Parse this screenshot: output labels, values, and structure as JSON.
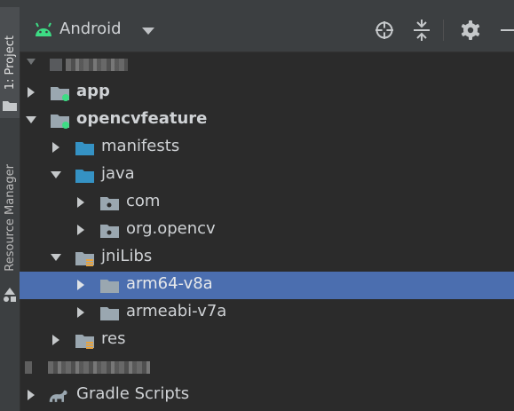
{
  "sidebar": {
    "project_tab": "1: Project",
    "resource_tab": "Resource Manager"
  },
  "toolbar": {
    "view_label": "Android",
    "icons": [
      "android-icon",
      "caret-down-icon",
      "locate-icon",
      "collapse-all-icon",
      "gear-icon",
      "hide-icon"
    ]
  },
  "tree": {
    "items": [
      {
        "label": "",
        "depth": 0,
        "expanded": true,
        "obscured": true
      },
      {
        "label": "app",
        "depth": 0,
        "expanded": false,
        "bold": true,
        "icon": "module-folder-icon"
      },
      {
        "label": "opencvfeature",
        "depth": 0,
        "expanded": true,
        "bold": true,
        "icon": "module-folder-icon"
      },
      {
        "label": "manifests",
        "depth": 1,
        "expanded": false,
        "icon": "folder-icon"
      },
      {
        "label": "java",
        "depth": 1,
        "expanded": true,
        "icon": "source-folder-icon"
      },
      {
        "label": "com",
        "depth": 2,
        "expanded": false,
        "icon": "package-icon"
      },
      {
        "label": "org.opencv",
        "depth": 2,
        "expanded": false,
        "icon": "package-icon"
      },
      {
        "label": "jniLibs",
        "depth": 1,
        "expanded": true,
        "icon": "resource-folder-icon"
      },
      {
        "label": "arm64-v8a",
        "depth": 2,
        "expanded": false,
        "icon": "folder-icon",
        "selected": true
      },
      {
        "label": "armeabi-v7a",
        "depth": 2,
        "expanded": false,
        "icon": "folder-icon"
      },
      {
        "label": "res",
        "depth": 1,
        "expanded": false,
        "icon": "resource-folder-icon"
      },
      {
        "label": "",
        "depth": 0,
        "obscured": true
      },
      {
        "label": "Gradle Scripts",
        "depth": 0,
        "expanded": false,
        "icon": "gradle-icon"
      }
    ]
  },
  "colors": {
    "background": "#2b2b2b",
    "toolbar": "#3c3f41",
    "selection": "#4b6eaf",
    "text": "#cfd2d5",
    "android_green": "#3ddc84",
    "folder_blue": "#3592c4",
    "folder_gray": "#9aa7b0",
    "module_dot": "#3ddc84",
    "resource_bars": "#e8a33d"
  }
}
